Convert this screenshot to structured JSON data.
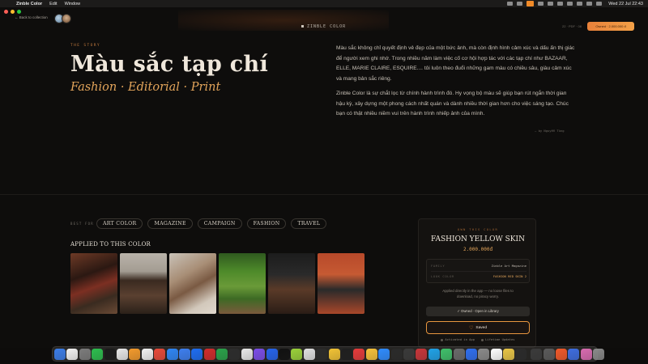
{
  "menubar": {
    "app_name": "Zinble Color",
    "menus": [
      "Edit",
      "Window"
    ],
    "clock": "Wed 22 Jul  22:43"
  },
  "header": {
    "back_label": "← Back to collection",
    "brand": "ZINBLE COLOR",
    "version": "22 · PDF · 08",
    "owned_label": "Owned · 2.000.000 đ"
  },
  "story": {
    "eyebrow": "THE STORY",
    "title": "Màu sắc tạp chí",
    "subtitle": "Fashion · Editorial · Print",
    "paragraphs": [
      "Màu sắc không chỉ quyết định vẻ đẹp của một bức ảnh, mà còn định hình cảm xúc và dấu ấn thị giác để người xem ghi nhớ. Trong nhiều năm làm việc cố cơ hội hợp tác với các tạp chí như BAZAAR, ELLE, MARIE CLAIRE, ESQUIRE.... tôi luôn theo đuổi những gam màu có chiều sâu, giàu cảm xúc và mang bản sắc riêng.",
      "Zinble Color là sự chắt lọc từ chính hành trình đó. Hy vọng bộ màu sẽ giúp bạn rút ngắn thời gian hậu kỳ, xây dựng một phong cách nhất quán và dành nhiều thời gian hơn cho việc sáng tạo. Chúc bạn có thật nhiều niềm vui trên hành trình nhiếp ảnh của mình."
    ],
    "signature": "— by Nguyễn Tùng"
  },
  "best_for": {
    "label": "BEST FOR",
    "tags": [
      "ART COLOR",
      "MAGAZINE",
      "CAMPAIGN",
      "FASHION",
      "TRAVEL"
    ]
  },
  "applied": {
    "title": "APPLIED TO THIS COLOR"
  },
  "card": {
    "eyebrow": "OWN THIS COLOR",
    "title": "FASHION YELLOW SKIN",
    "price": "2.000.000đ",
    "rows": [
      {
        "key": "FAMILY",
        "value": "Zinble Art Magazine"
      },
      {
        "key": "LOOK COLOR",
        "value": "FASHION RED SKIN 2"
      }
    ],
    "note": "Applied directly in the app — no loose files to download, no piracy worry.",
    "library_button": "✓ Owned · Open in Library",
    "saved_button": "Saved",
    "features": [
      "Activated in App",
      "Lifetime Updates"
    ]
  },
  "dock": {
    "colors": [
      "#3b7de8",
      "#f2f2f2",
      "#7c7c7c",
      "#2dbd4e",
      "#1b1b1b",
      "#e8e8e8",
      "#f39a2c",
      "#f2f2f2",
      "#e84a3a",
      "#2f86f5",
      "#3d7ff0",
      "#1d6df2",
      "#d22c2c",
      "#2aa24a",
      "#2d2d2d",
      "#e9e9e9",
      "#7b4de8",
      "#2563eb",
      "#111111",
      "#9ad13a",
      "#e0e0e0",
      "#2b2b2b",
      "#f2c335",
      "#1f1f1f",
      "#e53b3b",
      "#f7c23a",
      "#2f8cff",
      "#2a2a2a",
      "#3a3a3a",
      "#c7363a",
      "#20a2e8",
      "#3fbf6a",
      "#6a6a6a",
      "#2f6ff0",
      "#8a8a8a",
      "#ffffff",
      "#e8c547",
      "#2b2b2b",
      "#3b3b3b",
      "#5a5a5a",
      "#f0592a",
      "#3e6de0",
      "#d86bb0",
      "#8a8a8a"
    ]
  }
}
